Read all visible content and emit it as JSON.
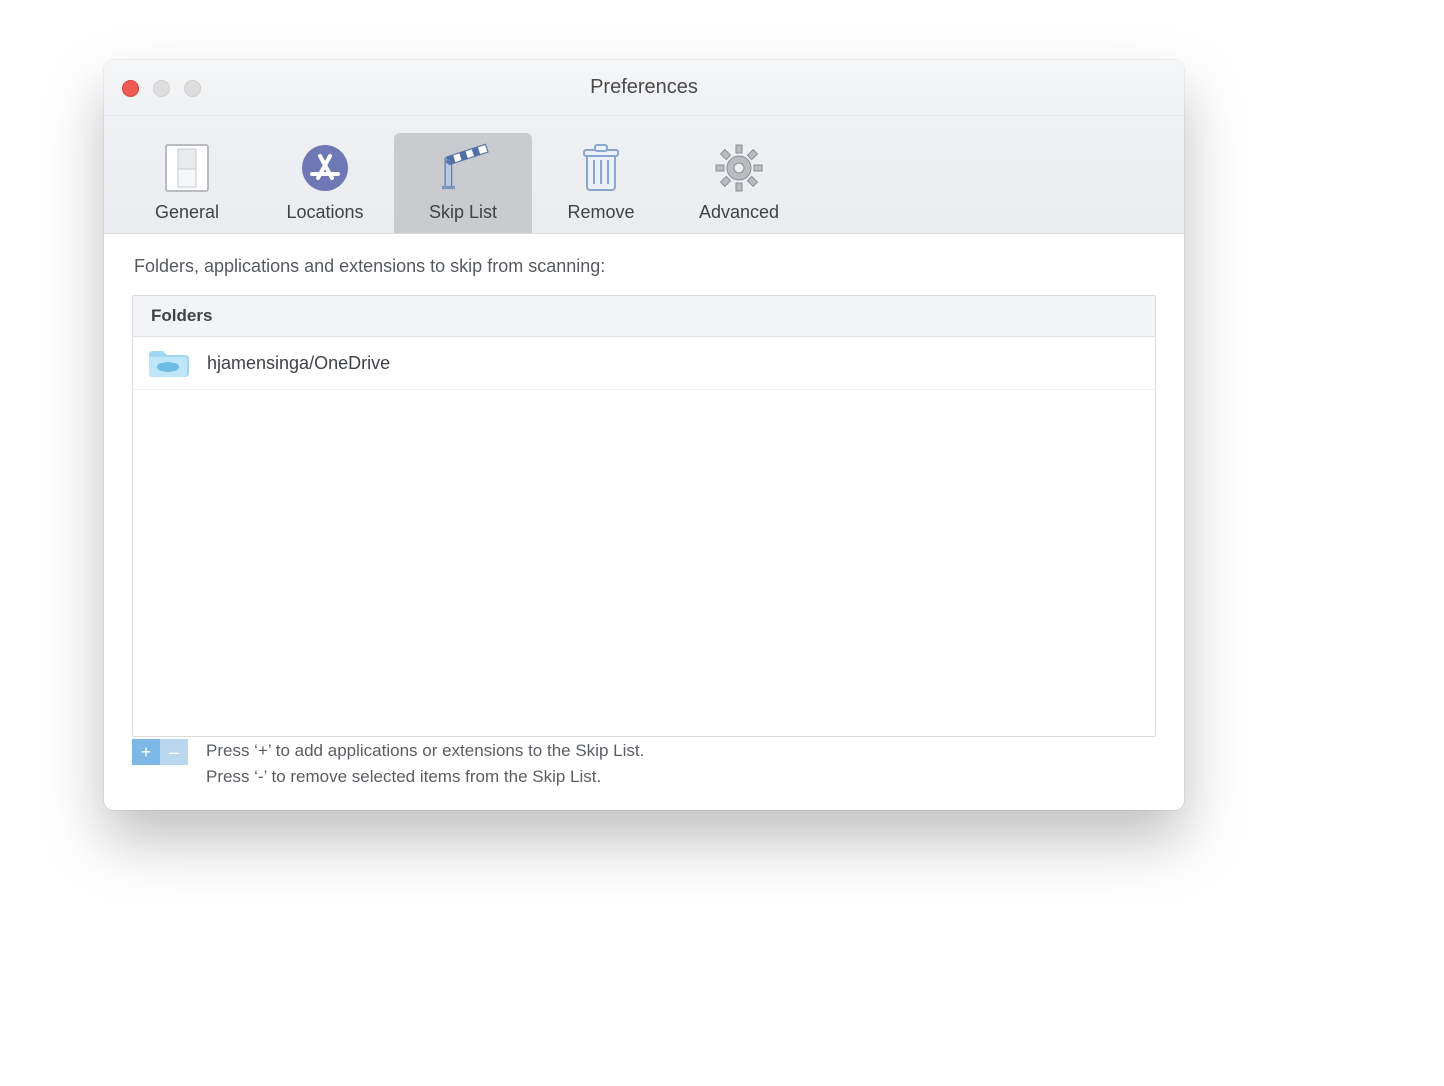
{
  "window": {
    "title": "Preferences"
  },
  "tabs": [
    {
      "label": "General",
      "icon": "switch-icon",
      "selected": false
    },
    {
      "label": "Locations",
      "icon": "appstore-icon",
      "selected": false
    },
    {
      "label": "Skip List",
      "icon": "barrier-icon",
      "selected": true
    },
    {
      "label": "Remove",
      "icon": "trash-icon",
      "selected": false
    },
    {
      "label": "Advanced",
      "icon": "gear-icon",
      "selected": false
    }
  ],
  "skiplist": {
    "description": "Folders, applications and extensions to skip from scanning:",
    "section_header": "Folders",
    "items": [
      {
        "path": "hjamensinga/OneDrive",
        "icon": "cloud-folder-icon"
      }
    ],
    "help_add": "Press ‘+’ to add applications or extensions to the Skip List.",
    "help_remove": "Press ‘-’  to remove selected items from the Skip List.",
    "btn_add_glyph": "+",
    "btn_rem_glyph": "–"
  }
}
